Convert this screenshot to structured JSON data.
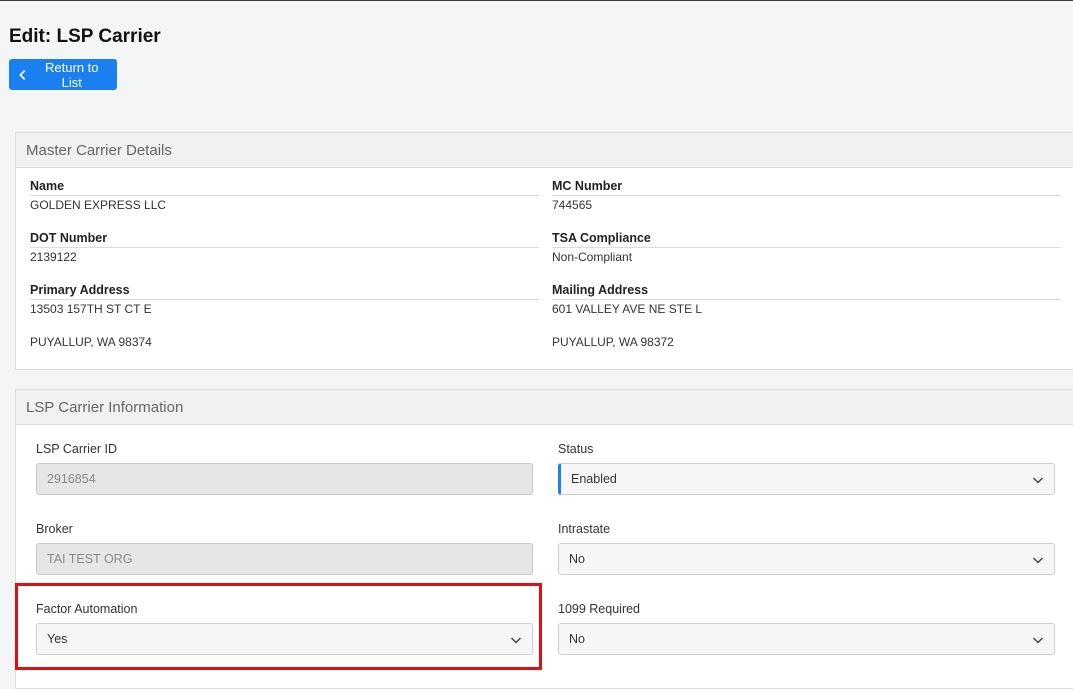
{
  "page": {
    "title": "Edit: LSP Carrier",
    "return_label": "Return to List"
  },
  "master": {
    "header": "Master Carrier Details",
    "name_label": "Name",
    "name_value": "GOLDEN EXPRESS LLC",
    "mc_label": "MC Number",
    "mc_value": "744565",
    "dot_label": "DOT Number",
    "dot_value": "2139122",
    "tsa_label": "TSA Compliance",
    "tsa_value": "Non-Compliant",
    "primary_label": "Primary Address",
    "primary_line1": "13503 157TH ST CT E",
    "primary_line2": "PUYALLUP, WA 98374",
    "mailing_label": "Mailing Address",
    "mailing_line1": "601 VALLEY AVE NE STE L",
    "mailing_line2": "PUYALLUP, WA 98372"
  },
  "lsp": {
    "header": "LSP Carrier Information",
    "carrier_id_label": "LSP Carrier ID",
    "carrier_id_value": "2916854",
    "status_label": "Status",
    "status_value": "Enabled",
    "broker_label": "Broker",
    "broker_value": "TAI TEST ORG",
    "intrastate_label": "Intrastate",
    "intrastate_value": "No",
    "factor_label": "Factor Automation",
    "factor_value": "Yes",
    "req1099_label": "1099 Required",
    "req1099_value": "No"
  },
  "icons": {
    "back": "chevron-left-icon",
    "dropdown": "chevron-down-icon"
  },
  "colors": {
    "primary": "#1a7ff0",
    "highlight": "#e01010"
  }
}
